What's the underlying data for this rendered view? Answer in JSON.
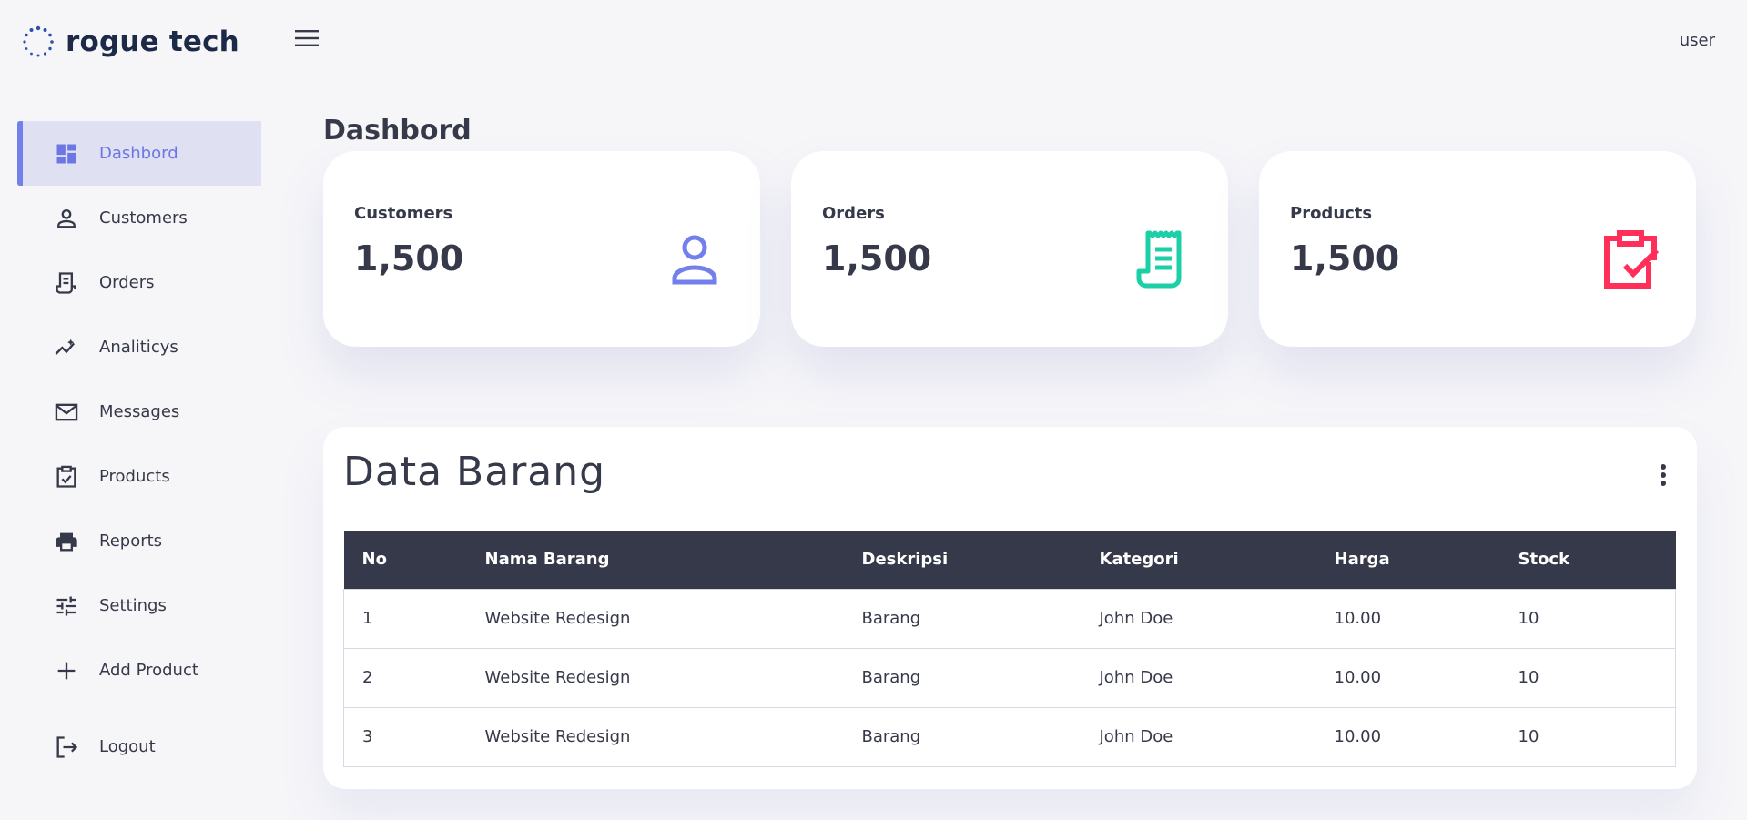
{
  "brand": {
    "name": "rogue tech",
    "logo_icon": "dotted-circle-icon",
    "accent": "#7380ec"
  },
  "header": {
    "user": "user",
    "menu_icon": "hamburger-icon"
  },
  "sidebar": {
    "items": [
      {
        "label": "Dashbord",
        "icon": "dashboard-icon",
        "active": true
      },
      {
        "label": "Customers",
        "icon": "person-icon"
      },
      {
        "label": "Orders",
        "icon": "receipt-icon"
      },
      {
        "label": "Analiticys",
        "icon": "trending-icon"
      },
      {
        "label": "Messages",
        "icon": "mail-icon"
      },
      {
        "label": "Products",
        "icon": "clipboard-check-icon"
      },
      {
        "label": "Reports",
        "icon": "printer-icon"
      },
      {
        "label": "Settings",
        "icon": "tune-icon"
      },
      {
        "label": "Add Product",
        "icon": "plus-icon"
      },
      {
        "label": "Logout",
        "icon": "logout-icon"
      }
    ]
  },
  "main": {
    "title": "Dashbord",
    "cards": [
      {
        "label": "Customers",
        "value": "1,500",
        "icon": "person-icon",
        "color": "#7380ec"
      },
      {
        "label": "Orders",
        "value": "1,500",
        "icon": "receipt-icon",
        "color": "#1ccfa6"
      },
      {
        "label": "Products",
        "value": "1,500",
        "icon": "clipboard-check-icon",
        "color": "#ff2f5a"
      }
    ]
  },
  "table_panel": {
    "title": "Data Barang",
    "more_icon": "more-vertical-icon",
    "columns": [
      "No",
      "Nama Barang",
      "Deskripsi",
      "Kategori",
      "Harga",
      "Stock"
    ],
    "rows": [
      [
        "1",
        "Website Redesign",
        "Barang",
        "John Doe",
        "10.00",
        "10"
      ],
      [
        "2",
        "Website Redesign",
        "Barang",
        "John Doe",
        "10.00",
        "10"
      ],
      [
        "3",
        "Website Redesign",
        "Barang",
        "John Doe",
        "10.00",
        "10"
      ]
    ]
  }
}
